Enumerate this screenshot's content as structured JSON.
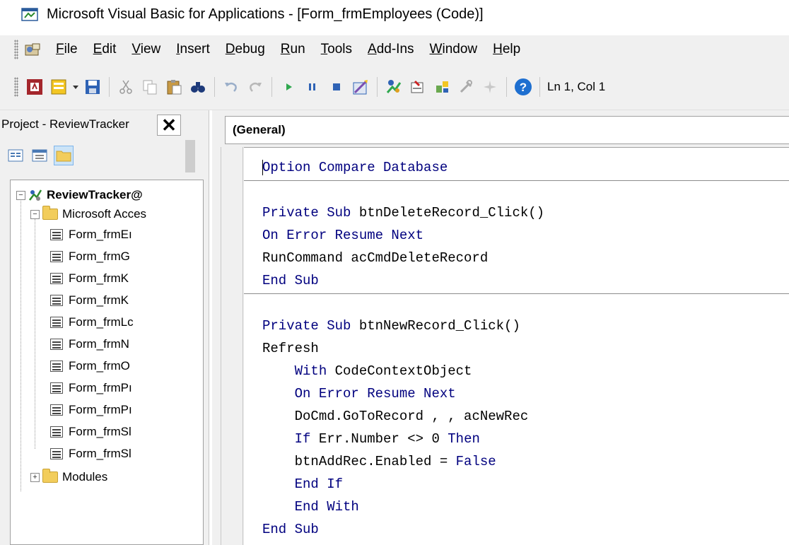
{
  "window": {
    "title": "Microsoft Visual Basic for Applications - [Form_frmEmployees (Code)]"
  },
  "menu": {
    "items": [
      {
        "label": "File",
        "underline": "F",
        "rest": "ile"
      },
      {
        "label": "Edit",
        "underline": "E",
        "rest": "dit"
      },
      {
        "label": "View",
        "underline": "V",
        "rest": "iew"
      },
      {
        "label": "Insert",
        "underline": "I",
        "rest": "nsert"
      },
      {
        "label": "Debug",
        "underline": "D",
        "rest": "ebug"
      },
      {
        "label": "Run",
        "underline": "R",
        "rest": "un"
      },
      {
        "label": "Tools",
        "underline": "T",
        "rest": "ools"
      },
      {
        "label": "Add-Ins",
        "underline": "A",
        "rest": "dd-Ins"
      },
      {
        "label": "Window",
        "underline": "W",
        "rest": "indow"
      },
      {
        "label": "Help",
        "underline": "H",
        "rest": "elp"
      }
    ]
  },
  "toolbar": {
    "position": "Ln 1, Col 1"
  },
  "project": {
    "title": "Project - ReviewTracker",
    "close_glyph": "✕",
    "tree": {
      "root": "ReviewTracker@",
      "group": "Microsoft Acces",
      "forms": [
        "Form_frmEı",
        "Form_frmG",
        "Form_frmK",
        "Form_frmK",
        "Form_frmLc",
        "Form_frmN",
        "Form_frmO",
        "Form_frmPı",
        "Form_frmPı",
        "Form_frmSl",
        "Form_frmSl"
      ],
      "modules": "Modules"
    }
  },
  "code": {
    "object_combo": "(General)",
    "lines": [
      {
        "kw": "Option Compare Database",
        "rest": ""
      },
      {
        "kw": "",
        "rest": ""
      },
      {
        "kw": "Private Sub",
        "rest": " btnDeleteRecord_Click()"
      },
      {
        "kw": "On Error Resume Next",
        "rest": ""
      },
      {
        "kw": "",
        "rest": "RunCommand acCmdDeleteRecord"
      },
      {
        "kw": "End Sub",
        "rest": ""
      },
      {
        "kw": "",
        "rest": ""
      },
      {
        "kw": "Private Sub",
        "rest": " btnNewRecord_Click()"
      },
      {
        "kw": "",
        "rest": "Refresh"
      },
      {
        "kw": "    With",
        "rest": " CodeContextObject"
      },
      {
        "kw": "    On Error Resume Next",
        "rest": ""
      },
      {
        "kw": "",
        "rest": "    DoCmd.GoToRecord , , acNewRec"
      },
      {
        "kw": "    If",
        "rest": " Err.Number <> 0 ",
        "kw2": "Then"
      },
      {
        "kw": "",
        "rest": "    btnAddRec.Enabled = ",
        "kw2": "False"
      },
      {
        "kw": "    End If",
        "rest": ""
      },
      {
        "kw": "    End With",
        "rest": ""
      },
      {
        "kw": "End Sub",
        "rest": ""
      }
    ]
  }
}
